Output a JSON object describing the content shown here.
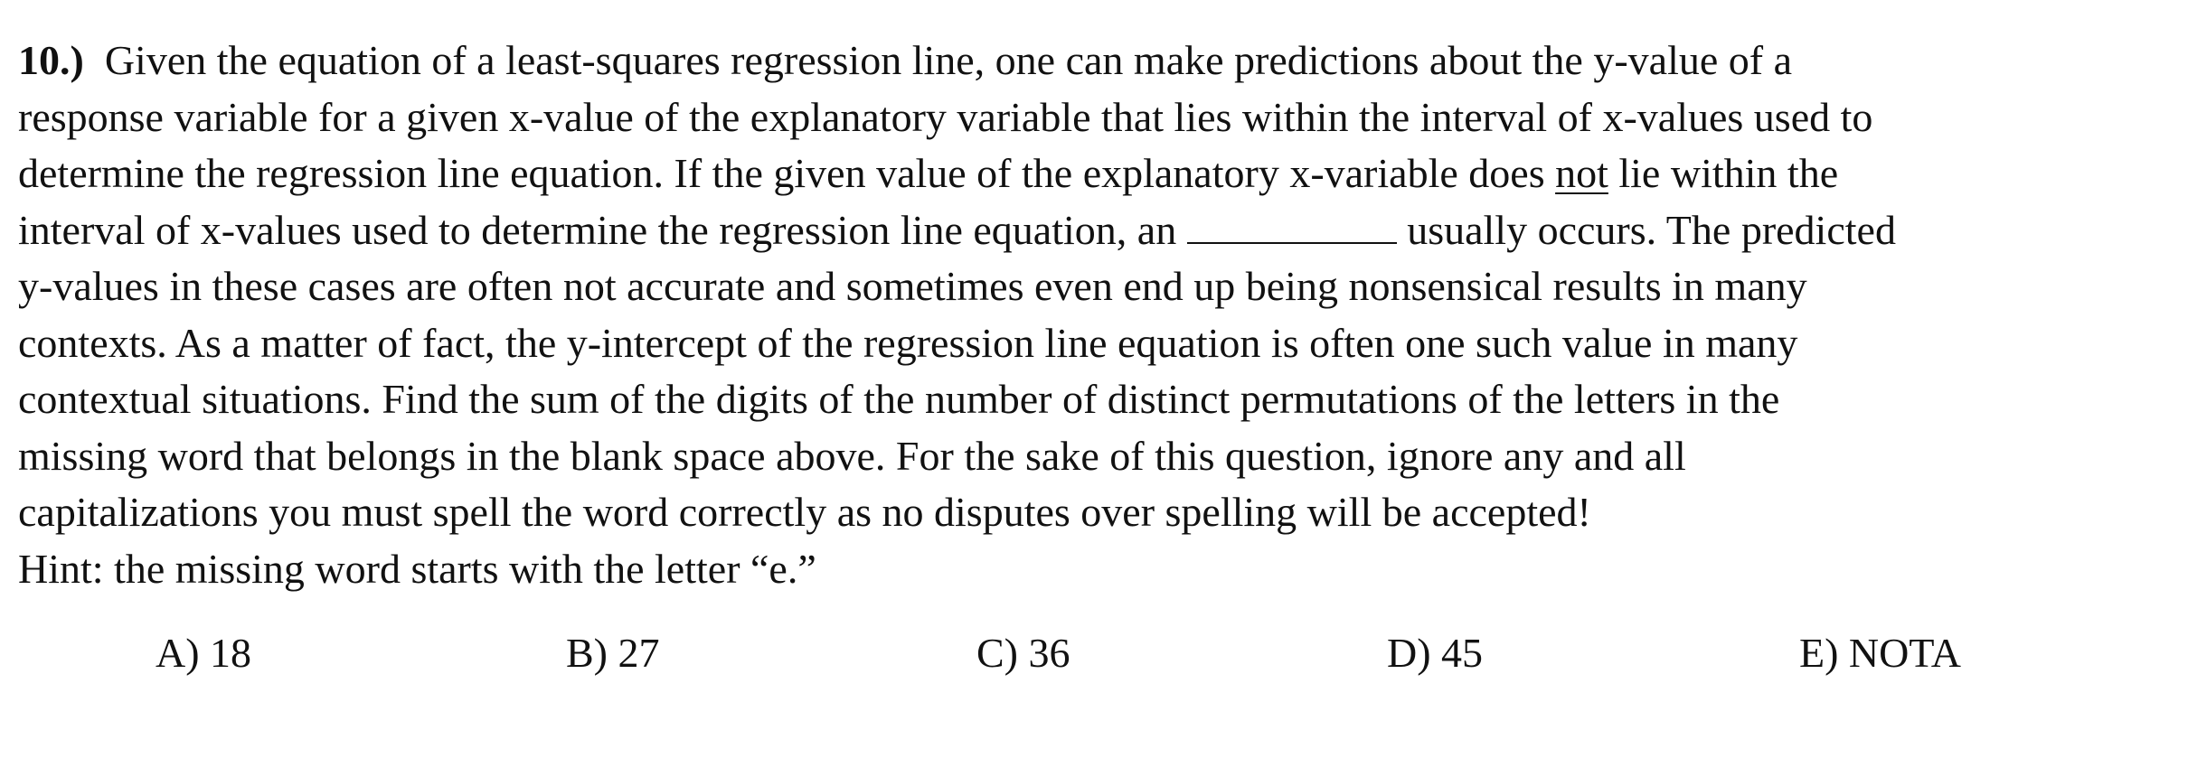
{
  "question": {
    "number": "10.)",
    "line1": "Given the equation of a least-squares regression line, one can make predictions about the y-value of a",
    "line2": "response variable for a given x-value of the explanatory variable that lies within the interval of x-values used to",
    "line3_part1": "determine the regression line equation.  If the given value of the explanatory x-variable does ",
    "line3_underlined": "not",
    "line3_part2": " lie within the",
    "line4_part1": "interval of x-values used to determine the regression line equation, an ",
    "line4_part2": " usually occurs.  The predicted",
    "line5": "y-values in these cases are often not accurate and sometimes even end up being nonsensical results in many",
    "line6": "contexts.  As a matter of fact, the y-intercept of the regression line equation is often one such value in many",
    "line7": "contextual situations.  Find the sum of the digits of the number of distinct permutations of the letters in the",
    "line8": "missing word that belongs in the blank space above.  For the sake of this question, ignore any and all",
    "line9": "capitalizations you must spell the word correctly as no disputes over spelling will be accepted!",
    "hint": "Hint: the missing word starts with the letter “e.”"
  },
  "choices": [
    {
      "label": "A) 18"
    },
    {
      "label": "B) 27"
    },
    {
      "label": "C) 36"
    },
    {
      "label": "D) 45"
    },
    {
      "label": "E) NOTA"
    }
  ]
}
